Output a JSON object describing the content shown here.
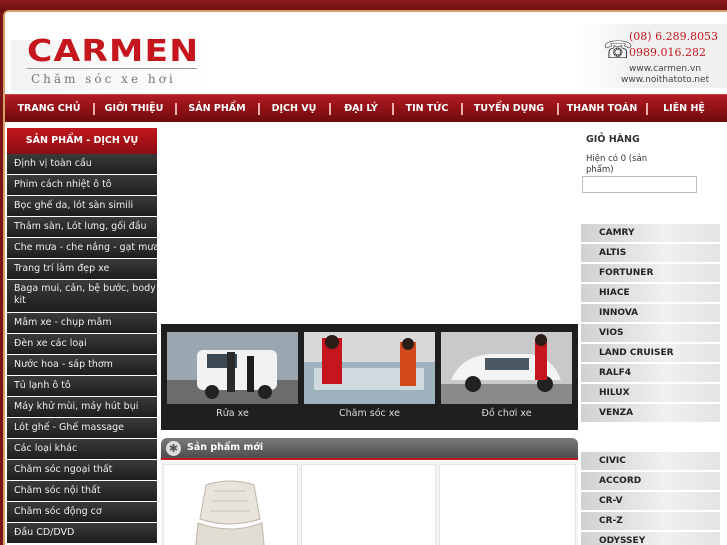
{
  "brand": {
    "logo": "CARMEN",
    "tagline": "Chăm sóc xe hơi"
  },
  "contact": {
    "phone1": "(08) 6.289.8053",
    "phone2": "0989.016.282",
    "website1": "www.carmen.vn",
    "website2": "www.noithatoto.net",
    "icon": "phone-icon"
  },
  "nav": {
    "items": [
      "TRANG CHỦ",
      "GIỚI THIỆU",
      "SẢN PHẨM",
      "DỊCH VỤ",
      "ĐẠI LÝ",
      "TIN TỨC",
      "TUYỂN DỤNG",
      "THANH TOÁN",
      "LIÊN HỆ"
    ]
  },
  "sidebar": {
    "title": "SẢN PHẨM - DỊCH VỤ",
    "items": [
      "Định vị toàn cầu",
      "Phim cách nhiệt ô tô",
      "Bọc ghế da, lót sàn simili",
      "Thảm sàn, Lót lưng, gối đầu",
      "Che mưa - che nắng - gạt mưa",
      "Trang trí làm đẹp xe",
      "Baga mui, cản, bệ bước, body kit",
      "Mâm xe - chụp mâm",
      "Đèn xe các loại",
      "Nước hoa - sáp thơm",
      "Tủ lạnh ô tô",
      "Máy khử mùi, máy hút bụi",
      "Lót ghế - Ghế massage",
      "Các loại khác",
      "Chăm sóc ngoại thất",
      "Chăm sóc nội thất",
      "Chăm sóc động cơ",
      "Đầu CD/DVD"
    ]
  },
  "gallery": {
    "items": [
      {
        "caption": "Rửa xe"
      },
      {
        "caption": "Chăm sóc xe"
      },
      {
        "caption": "Đồ chơi xe"
      }
    ]
  },
  "new_products": {
    "title": "Sản phẩm mới",
    "icon": "star-icon"
  },
  "cart": {
    "title": "GIỎ HÀNG",
    "status": "Hiện có 0 (sản phẩm)"
  },
  "models_toyota": [
    "CAMRY",
    "ALTIS",
    "FORTUNER",
    "HIACE",
    "INNOVA",
    "VIOS",
    "LAND CRUISER",
    "RALF4",
    "HILUX",
    "VENZA"
  ],
  "models_honda": [
    "CIVIC",
    "ACCORD",
    "CR-V",
    "CR-Z",
    "ODYSSEY"
  ],
  "colors": {
    "brand_red": "#c4161c",
    "nav_dark_red": "#8e1116",
    "sidebar_dark": "#1e1e1e"
  }
}
